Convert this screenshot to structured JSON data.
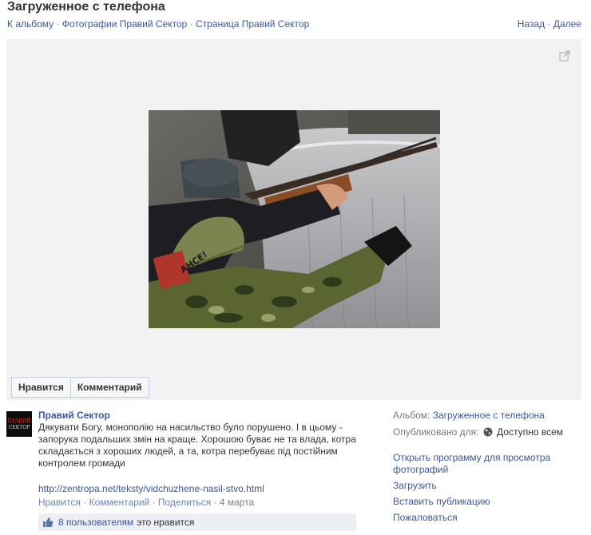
{
  "page": {
    "title": "Загруженное с телефона",
    "breadcrumbs": [
      {
        "label": "К альбому"
      },
      {
        "label": "Фотографии Правий Сектор"
      },
      {
        "label": "Страница Правий Сектор"
      }
    ],
    "separator": "·",
    "prev_label": "Назад",
    "next_label": "Далее"
  },
  "photo": {
    "helmet_text": "AHCE!",
    "expand_icon": "expand-icon"
  },
  "actions": {
    "like_label": "Нравится",
    "comment_label": "Комментарий"
  },
  "post": {
    "avatar_text_top": "ПРАВИЙ",
    "avatar_text_bottom": "СЕКТОР",
    "author": "Правий Сектор",
    "text": "Дякувати Богу, монополію на насильство було порушено. І в цьому - запорука подальших змін на краще. Хорошою буває не та влада, котра складається з хороших людей, а та, котра перебуває під постійним контролем громади",
    "link": "http://zentropa.net/teksty/vidchuzhene-nasil-stvo.html",
    "meta": {
      "like": "Нравится",
      "comment": "Комментарий",
      "share": "Поделиться",
      "date": "4 марта"
    },
    "likes": {
      "count": "8 пользователям",
      "rest": "это нравится"
    }
  },
  "side": {
    "album_label": "Альбом:",
    "album_value": "Загруженное с телефона",
    "published_label": "Опубликовано для:",
    "published_value": "Доступно всем",
    "links": [
      {
        "label": "Открыть программу для просмотра фотографий"
      },
      {
        "label": "Загрузить"
      },
      {
        "label": "Вставить публикацию"
      },
      {
        "label": "Пожаловаться"
      }
    ]
  },
  "colors": {
    "link": "#3b5998",
    "stage_bg": "#f2f2f2"
  }
}
